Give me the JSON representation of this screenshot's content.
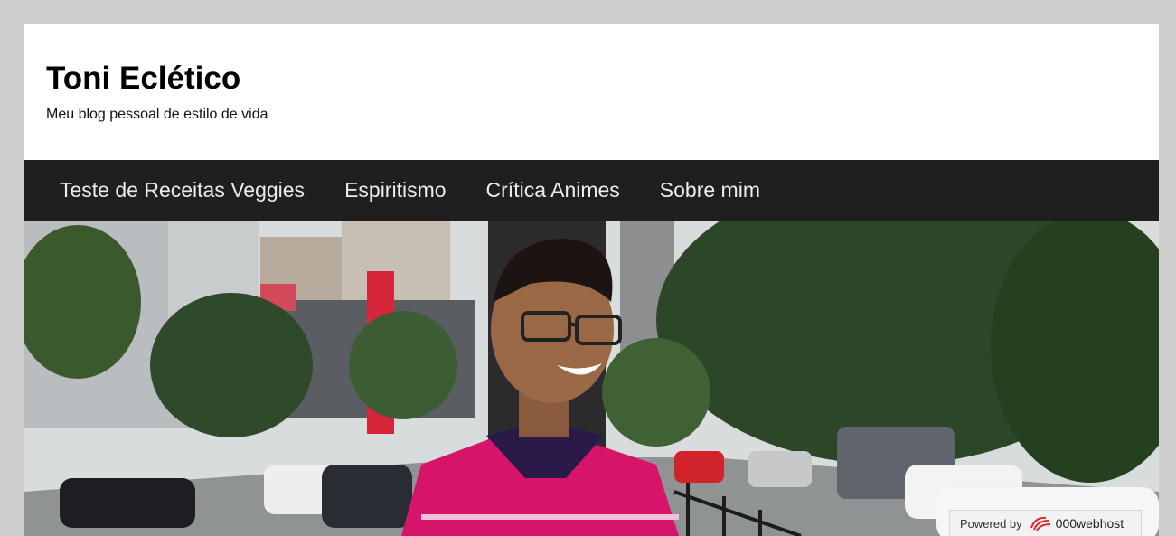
{
  "site": {
    "title": "Toni Eclético",
    "tagline": "Meu blog pessoal de estilo de vida"
  },
  "nav": {
    "items": [
      {
        "label": "Teste de Receitas Veggies"
      },
      {
        "label": "Espiritismo"
      },
      {
        "label": "Crítica Animes"
      },
      {
        "label": "Sobre mim"
      }
    ]
  },
  "hero": {
    "image_description_name": "header-photo",
    "colors": {
      "sky": "#d9dcdc",
      "shirt": "#d6156a",
      "collar": "#2a1a4a",
      "foliage": "#2f4a2a"
    }
  },
  "footer_badge": {
    "powered_label": "Powered by",
    "brand": "000webhost",
    "icon": "webhost-logo-icon",
    "brand_color": "#e0252a"
  }
}
